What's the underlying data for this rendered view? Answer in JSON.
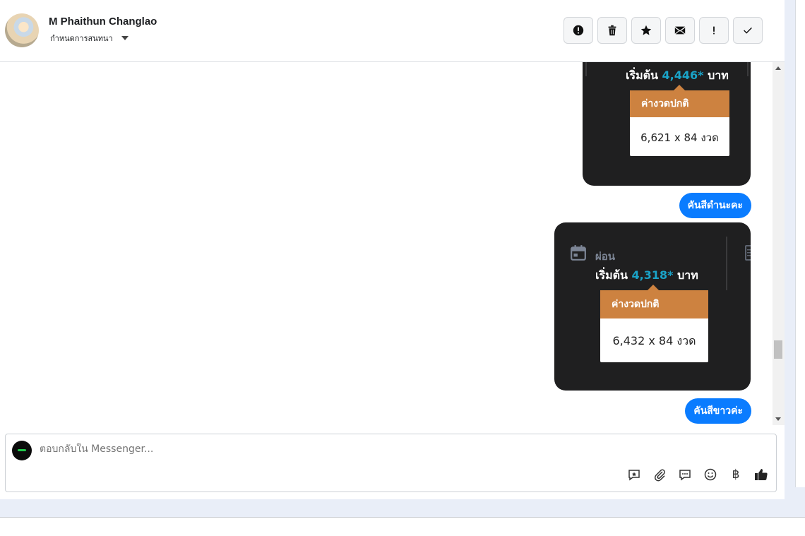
{
  "header": {
    "contact_name": "M Phaithun Changlao",
    "assign_label": "กำหนดการสนทนา",
    "actions": [
      {
        "name": "report-spam-button",
        "icon": "exclamation-circle-icon"
      },
      {
        "name": "delete-button",
        "icon": "trash-icon"
      },
      {
        "name": "star-button",
        "icon": "star-icon"
      },
      {
        "name": "mark-unread-button",
        "icon": "envelope-icon"
      },
      {
        "name": "important-button",
        "icon": "exclamation-icon"
      },
      {
        "name": "mark-done-button",
        "icon": "check-icon"
      }
    ]
  },
  "messages": {
    "card1": {
      "start_prefix": "เริ่มต้น",
      "start_price": "4,446*",
      "start_suffix": "บาท",
      "installment_title": "ค่างวดปกติ",
      "installment_value": "6,621 x 84 งวด"
    },
    "bubble1": "คันสีดำนะคะ",
    "card2": {
      "plan_label": "ผ่อน",
      "start_prefix": "เริ่มต้น",
      "start_price": "4,318*",
      "start_suffix": "บาท",
      "installment_title": "ค่างวดปกติ",
      "installment_value": "6,432 x 84 งวด"
    },
    "bubble2": "คันสีขาวค่ะ"
  },
  "composer": {
    "placeholder": "ตอบกลับใน Messenger...",
    "tools": [
      "saved-reply-icon",
      "attachment-icon",
      "chat-bubble-icon",
      "emoji-icon",
      "baht-icon",
      "thumbs-up-icon"
    ],
    "baht_symbol": "฿"
  },
  "colors": {
    "accent": "#0a7cff",
    "card_bg": "#1f1f20",
    "price_teal": "#1aa3c8",
    "installment_orange": "#cd8240"
  }
}
